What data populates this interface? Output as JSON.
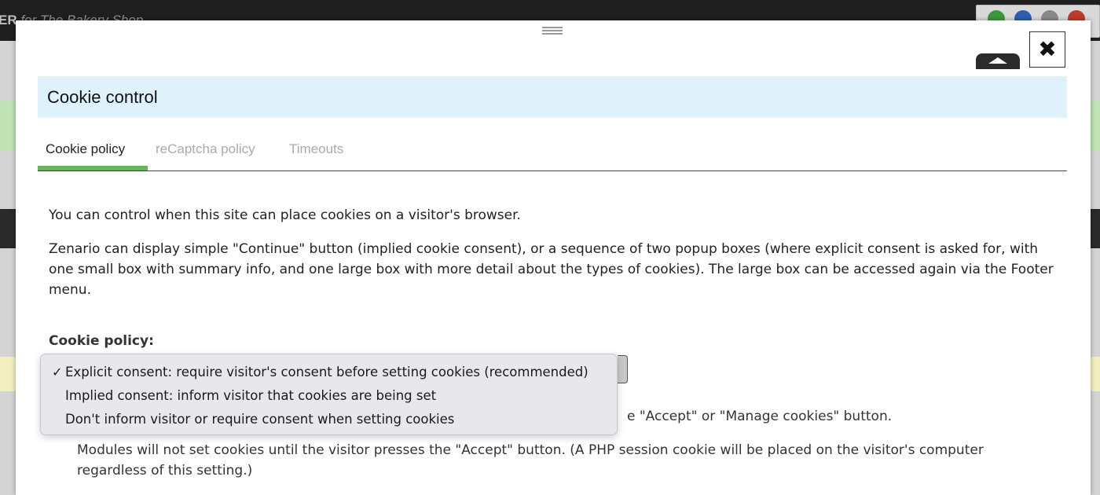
{
  "background": {
    "brand_prefix": "ER",
    "brand_suffix": "for The Bakery Shop"
  },
  "modal": {
    "title": "Cookie control",
    "close_icon": "✖",
    "tabs": [
      {
        "label": "Cookie policy",
        "active": true
      },
      {
        "label": "reCaptcha policy",
        "active": false
      },
      {
        "label": "Timeouts",
        "active": false
      }
    ],
    "intro": "You can control when this site can place cookies on a visitor's browser.",
    "description": "Zenario can display simple \"Continue\" button (implied cookie consent), or a sequence of two popup boxes (where explicit consent is asked for, with one small box with summary info, and one large box with more detail about the types of cookies). The large box can be accessed again via the Footer menu.",
    "field_label": "Cookie policy:",
    "option_note_partial": "e \"Accept\" or \"Manage cookies\" button.",
    "option_description": "Modules will not set cookies until the visitor presses the \"Accept\" button. (A PHP session cookie will be placed on the visitor's computer regardless of this setting.)"
  },
  "dropdown": {
    "checkmark": "✓",
    "options": [
      {
        "label": "Explicit consent: require visitor's consent before setting cookies (recommended)",
        "selected": true
      },
      {
        "label": "Implied consent: inform visitor that cookies are being set",
        "selected": false
      },
      {
        "label": "Don't inform visitor or require consent when setting cookies",
        "selected": false
      }
    ]
  },
  "colors": {
    "title_bar": "#dff2fb",
    "tab_active_underline": "#5cbd4e"
  }
}
